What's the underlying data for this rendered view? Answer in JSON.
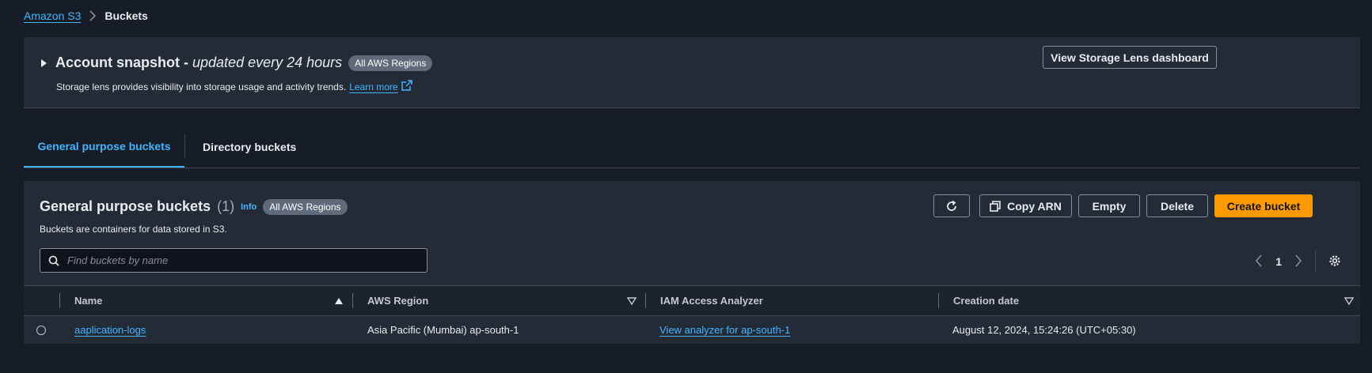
{
  "breadcrumb": {
    "root": "Amazon S3",
    "current": "Buckets"
  },
  "snapshot": {
    "title": "Account snapshot - ",
    "title_italic": "updated every 24 hours",
    "region_badge": "All AWS Regions",
    "description": "Storage lens provides visibility into storage usage and activity trends.",
    "learn_more": "Learn more",
    "button": "View Storage Lens dashboard"
  },
  "tabs": [
    {
      "label": "General purpose buckets",
      "active": true
    },
    {
      "label": "Directory buckets",
      "active": false
    }
  ],
  "buckets_panel": {
    "title": "General purpose buckets",
    "count": "(1)",
    "info": "Info",
    "region_badge": "All AWS Regions",
    "description": "Buckets are containers for data stored in S3.",
    "buttons": {
      "copy_arn": "Copy ARN",
      "empty": "Empty",
      "delete": "Delete",
      "create": "Create bucket"
    },
    "search_placeholder": "Find buckets by name",
    "page": "1"
  },
  "table": {
    "columns": [
      "Name",
      "AWS Region",
      "IAM Access Analyzer",
      "Creation date"
    ],
    "rows": [
      {
        "name": "aaplication-logs",
        "region": "Asia Pacific (Mumbai) ap-south-1",
        "analyzer": "View analyzer for ap-south-1",
        "created": "August 12, 2024, 15:24:26 (UTC+05:30)"
      }
    ]
  },
  "colors": {
    "link": "#42b4ff",
    "primary": "#ff9900",
    "background": "#161d26",
    "panel": "#232b37"
  }
}
